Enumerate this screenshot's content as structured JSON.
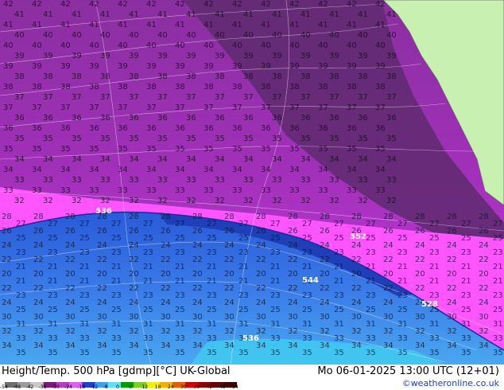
{
  "footer": {
    "title": "Height/Temp. 500 hPa [gdmp][°C] UK-Global",
    "datetime": "Mo 06-01-2025 13:00 UTC (12+01)",
    "credit": "©weatheronline.co.uk"
  },
  "colorbar": {
    "ticks": [
      "-54",
      "-48",
      "-42",
      "-38",
      "-30",
      "-24",
      "-18",
      "-12",
      "-8",
      "0",
      "8",
      "12",
      "18",
      "24",
      "30",
      "36",
      "42",
      "48",
      "54"
    ],
    "colors": [
      "#6e6e6e",
      "#9a9a9a",
      "#c8c8c8",
      "#7a1a7a",
      "#b040c0",
      "#e060f0",
      "#2040d0",
      "#3aa0f0",
      "#60e0f0",
      "#00a000",
      "#7cd020",
      "#f0f000",
      "#f0b000",
      "#e06000",
      "#d00000",
      "#900000",
      "#600000",
      "#400000"
    ]
  },
  "map": {
    "colors": {
      "dark_purple": "#5e2a6e",
      "purple": "#8a2fa0",
      "magenta": "#cc3ae0",
      "pink": "#ff55ff",
      "blue_dark": "#2a5ad8",
      "blue": "#3a7ae8",
      "blue_light": "#4aa8f0",
      "cyan": "#3fd0f0",
      "land": "#c8f0b0"
    },
    "contour_labels": {
      "upper": [
        "42",
        "41",
        "41",
        "40",
        "40",
        "39",
        "39",
        "38",
        "38",
        "37",
        "37",
        "36",
        "36",
        "35",
        "35",
        "34",
        "34",
        "33",
        "33",
        "32"
      ],
      "lower": [
        "28",
        "27",
        "26",
        "25",
        "24",
        "23",
        "22",
        "21",
        "20",
        "21",
        "22",
        "23",
        "24",
        "25",
        "30",
        "31",
        "32",
        "33",
        "34",
        "35",
        "36"
      ],
      "height_labels": [
        "528",
        "536",
        "536",
        "544",
        "552"
      ]
    }
  }
}
